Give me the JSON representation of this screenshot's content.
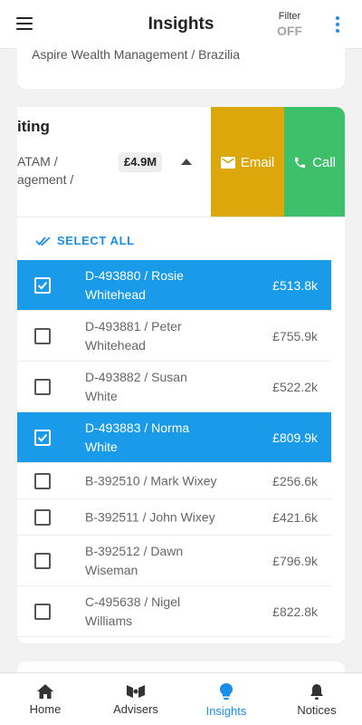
{
  "header": {
    "title": "Insights",
    "filter_label": "Filter",
    "filter_value": "OFF"
  },
  "top_card": {
    "text": "Aspire Wealth Management / Brazilia"
  },
  "group": {
    "title": "iting",
    "subtitle": "ATAM / agement /",
    "value": "£4.9M",
    "email_label": "Email",
    "call_label": "Call"
  },
  "select_all_label": "SELECT ALL",
  "accounts": [
    {
      "name": "D-493880 / Rosie Whitehead",
      "value": "£513.8k",
      "selected": true
    },
    {
      "name": "D-493881 / Peter Whitehead",
      "value": "£755.9k",
      "selected": false
    },
    {
      "name": "D-493882 / Susan White",
      "value": "£522.2k",
      "selected": false
    },
    {
      "name": "D-493883 / Norma White",
      "value": "£809.9k",
      "selected": true
    },
    {
      "name": "B-392510 / Mark Wixey",
      "value": "£256.6k",
      "selected": false
    },
    {
      "name": "B-392511 / John Wixey",
      "value": "£421.6k",
      "selected": false
    },
    {
      "name": "B-392512 / Dawn Wiseman",
      "value": "£796.9k",
      "selected": false
    },
    {
      "name": "C-495638 / Nigel Williams",
      "value": "£822.8k",
      "selected": false
    }
  ],
  "tabs": [
    {
      "label": "Home",
      "icon": "home-icon"
    },
    {
      "label": "Advisers",
      "icon": "advisers-icon"
    },
    {
      "label": "Insights",
      "icon": "lightbulb-icon",
      "active": true
    },
    {
      "label": "Notices",
      "icon": "bell-icon"
    }
  ],
  "colors": {
    "accent": "#1a8ee8",
    "selected_row": "#1a9be9",
    "email": "#dca70b",
    "call": "#3ebf6a"
  }
}
